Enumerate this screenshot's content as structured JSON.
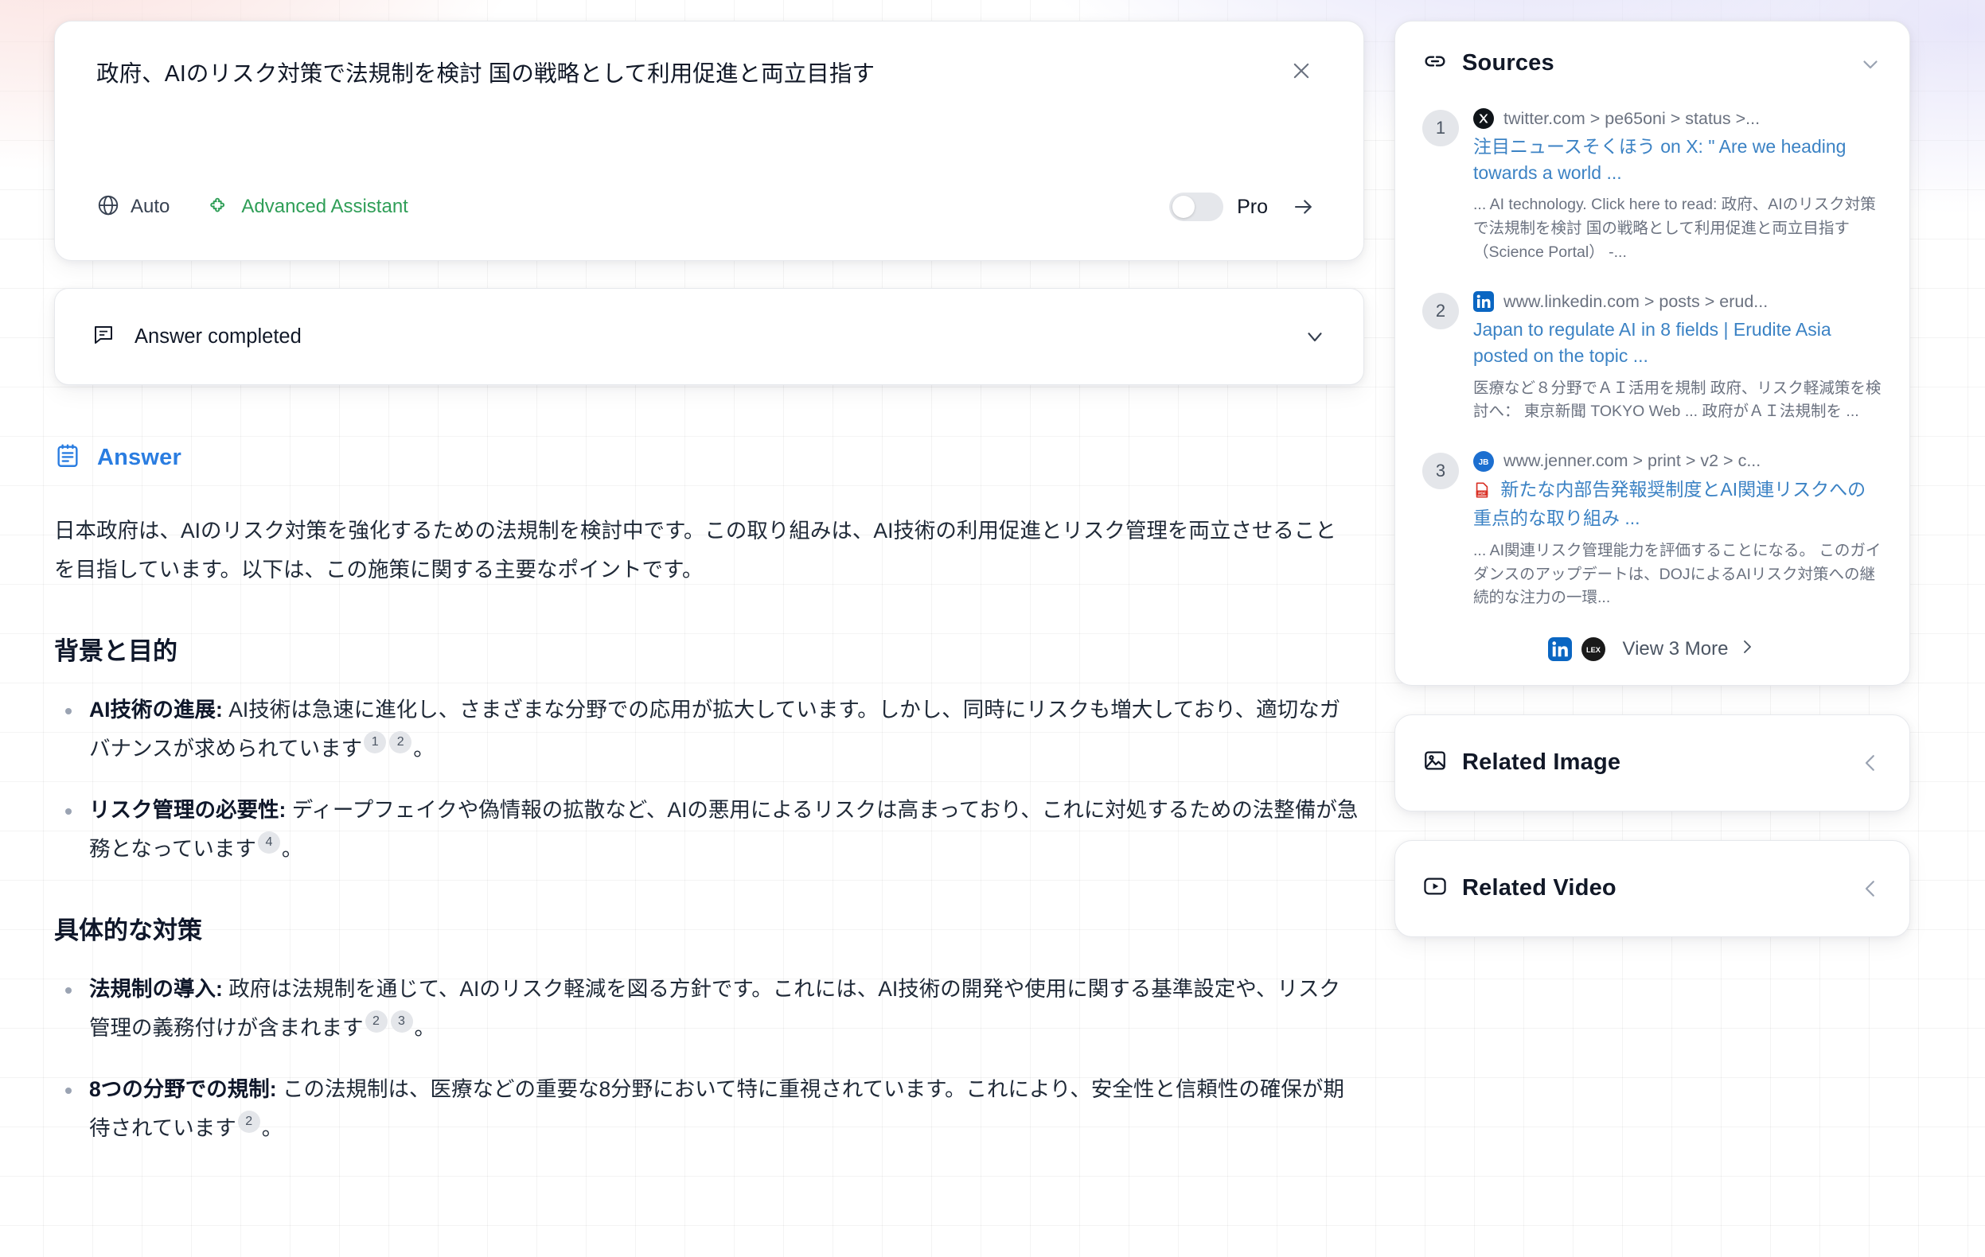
{
  "query": {
    "text": "政府、AIのリスク対策で法規制を検討 国の戦略として利用促進と両立目指す",
    "mode_label": "Auto",
    "assistant_label": "Advanced Assistant",
    "pro_label": "Pro",
    "accent_green": "#2f9e57"
  },
  "status": {
    "label": "Answer completed"
  },
  "answer": {
    "heading": "Answer",
    "heading_color": "#2a7de1",
    "intro": "日本政府は、AIのリスク対策を強化するための法規制を検討中です。この取り組みは、AI技術の利用促進とリスク管理を両立させることを目指しています。以下は、この施策に関する主要なポイントです。",
    "sections": [
      {
        "title": "背景と目的",
        "bullets": [
          {
            "title": "AI技術の進展:",
            "body": " AI技術は急速に進化し、さまざまな分野での応用が拡大しています。しかし、同時にリスクも増大しており、適切なガバナンスが求められています",
            "citations": [
              "1",
              "2"
            ],
            "tail": "。"
          },
          {
            "title": "リスク管理の必要性:",
            "body": " ディープフェイクや偽情報の拡散など、AIの悪用によるリスクは高まっており、これに対処するための法整備が急務となっています",
            "citations": [
              "4"
            ],
            "tail": "。"
          }
        ]
      },
      {
        "title": "具体的な対策",
        "bullets": [
          {
            "title": "法規制の導入:",
            "body": " 政府は法規制を通じて、AIのリスク軽減を図る方針です。これには、AI技術の開発や使用に関する基準設定や、リスク管理の義務付けが含まれます",
            "citations": [
              "2",
              "3"
            ],
            "tail": "。"
          },
          {
            "title": "8つの分野での規制:",
            "body": " この法規制は、医療などの重要な8分野において特に重視されています。これにより、安全性と信頼性の確保が期待されています",
            "citations": [
              "2"
            ],
            "tail": "。"
          }
        ]
      }
    ]
  },
  "sources": {
    "title": "Sources",
    "items": [
      {
        "num": "1",
        "url": "twitter.com > pe65oni > status >...",
        "favicon": "x-twitter-icon",
        "title": "注目ニュースそくほう on X: \" Are we heading towards a world ...",
        "snippet": "... AI technology. Click here to read: 政府、AIのリスク対策で法規制を検討 国の戦略として利用促進と両立目指す（Science Portal） -...",
        "is_pdf": false
      },
      {
        "num": "2",
        "url": "www.linkedin.com > posts > erud...",
        "favicon": "linkedin-icon",
        "title": "Japan to regulate AI in 8 fields | Erudite Asia posted on the topic ...",
        "snippet": "医療など８分野でＡＩ活用を規制 政府、リスク軽減策を検討へ： 東京新聞 TOKYO Web ... 政府がＡＩ法規制を ...",
        "is_pdf": false
      },
      {
        "num": "3",
        "url": "www.jenner.com > print > v2 > c...",
        "favicon": "jenner-icon",
        "title": "新たな内部告発報奨制度とAI関連リスクへの重点的な取り組み ...",
        "snippet": "... AI関連リスク管理能力を評価することになる。 このガイダンスのアップデートは、DOJによるAIリスク対策への継続的な注力の一環...",
        "is_pdf": true
      }
    ],
    "view_more_label": "View 3 More"
  },
  "related": [
    {
      "title": "Related Image",
      "icon": "image-icon"
    },
    {
      "title": "Related Video",
      "icon": "video-icon"
    }
  ]
}
